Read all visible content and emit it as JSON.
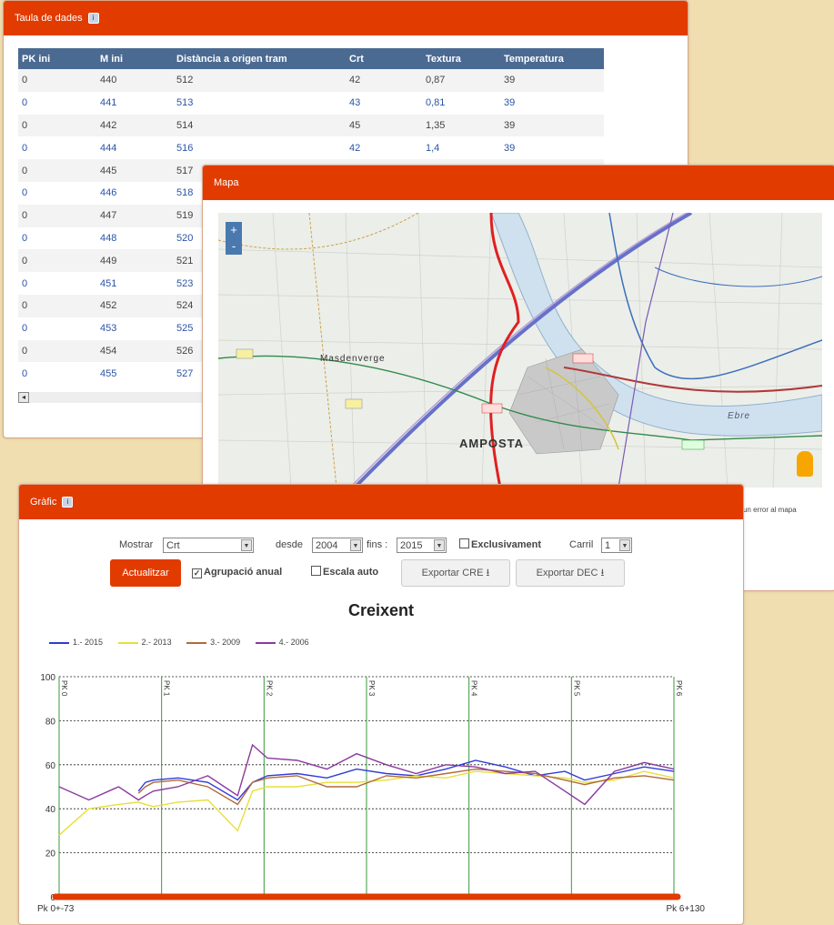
{
  "table_panel": {
    "title": "Taula de dades",
    "columns": [
      "PK ini",
      "M ini",
      "Distància a origen tram",
      "Crt",
      "Textura",
      "Temperatura"
    ],
    "rows": [
      [
        "0",
        "440",
        "512",
        "42",
        "0,87",
        "39"
      ],
      [
        "0",
        "441",
        "513",
        "43",
        "0,81",
        "39"
      ],
      [
        "0",
        "442",
        "514",
        "45",
        "1,35",
        "39"
      ],
      [
        "0",
        "444",
        "516",
        "42",
        "1,4",
        "39"
      ],
      [
        "0",
        "445",
        "517",
        "",
        "",
        ""
      ],
      [
        "0",
        "446",
        "518",
        "",
        "",
        ""
      ],
      [
        "0",
        "447",
        "519",
        "",
        "",
        ""
      ],
      [
        "0",
        "448",
        "520",
        "",
        "",
        ""
      ],
      [
        "0",
        "449",
        "521",
        "",
        "",
        ""
      ],
      [
        "0",
        "451",
        "523",
        "",
        "",
        ""
      ],
      [
        "0",
        "452",
        "524",
        "",
        "",
        ""
      ],
      [
        "0",
        "453",
        "525",
        "",
        "",
        ""
      ],
      [
        "0",
        "454",
        "526",
        "",
        "",
        ""
      ],
      [
        "0",
        "455",
        "527",
        "",
        "",
        ""
      ]
    ],
    "info_icon": "info-icon"
  },
  "map_panel": {
    "title": "Mapa",
    "place_labels": [
      "Masdenverge",
      "AMPOSTA",
      "Ebre"
    ],
    "attribution": "d'un error al mapa",
    "zoom_in": "+",
    "zoom_out": "-"
  },
  "chart_panel": {
    "title": "Gràfic",
    "controls": {
      "mostrar_label": "Mostrar",
      "mostrar_value": "Crt",
      "desde_label": "desde",
      "desde_value": "2004",
      "fins_label": "fins :",
      "fins_value": "2015",
      "exclusivament_label": "Exclusivament",
      "exclusivament_checked": false,
      "carril_label": "Carril",
      "carril_value": "1",
      "actualitzar_label": "Actualitzar",
      "agrupacio_label": "Agrupació anual",
      "agrupacio_checked": true,
      "escala_label": "Escala auto",
      "escala_checked": false,
      "export_cre_label": "Exportar CRE",
      "export_dec_label": "Exportar DEC"
    },
    "accent_color": "#e23b00"
  },
  "chart_data": {
    "type": "line",
    "title": "Creixent",
    "xlabel": "",
    "ylabel": "",
    "ylim": [
      0,
      100
    ],
    "yticks": [
      0,
      20,
      40,
      60,
      80,
      100
    ],
    "x_start_label": "Pk 0+-73",
    "x_end_label": "Pk 6+130",
    "pk_markers": [
      "PK 0",
      "PK 1",
      "PK 2",
      "PK 3",
      "PK 4",
      "PK 5",
      "PK 6"
    ],
    "legend_position": "top-left",
    "grid": true,
    "x": [
      0,
      0.3,
      0.6,
      0.8,
      0.87,
      0.95,
      1.2,
      1.5,
      1.8,
      1.95,
      2.1,
      2.4,
      2.7,
      3.0,
      3.3,
      3.6,
      3.9,
      4.2,
      4.5,
      4.8,
      5.1,
      5.3,
      5.6,
      5.9,
      6.2
    ],
    "series": [
      {
        "name": "1.- 2015",
        "color": "#2e3cd8",
        "values": [
          null,
          null,
          null,
          48,
          52,
          53,
          54,
          52,
          44,
          52,
          55,
          56,
          54,
          58,
          56,
          55,
          58,
          62,
          59,
          55,
          57,
          53,
          56,
          59,
          57
        ]
      },
      {
        "name": "2.- 2013",
        "color": "#e6e03a",
        "values": [
          28,
          40,
          42,
          43,
          42,
          41,
          43,
          44,
          30,
          48,
          50,
          50,
          52,
          52,
          53,
          55,
          54,
          57,
          56,
          55,
          54,
          52,
          53,
          57,
          54
        ]
      },
      {
        "name": "3.- 2009",
        "color": "#b06a3a",
        "values": [
          null,
          null,
          null,
          47,
          50,
          52,
          53,
          50,
          42,
          52,
          54,
          55,
          50,
          50,
          55,
          54,
          56,
          58,
          57,
          56,
          53,
          51,
          54,
          55,
          53
        ]
      },
      {
        "name": "4.- 2006",
        "color": "#8a3a9e",
        "values": [
          50,
          44,
          50,
          44,
          46,
          48,
          50,
          55,
          46,
          69,
          63,
          62,
          58,
          65,
          60,
          56,
          60,
          59,
          56,
          57,
          48,
          42,
          57,
          61,
          58
        ]
      }
    ]
  }
}
